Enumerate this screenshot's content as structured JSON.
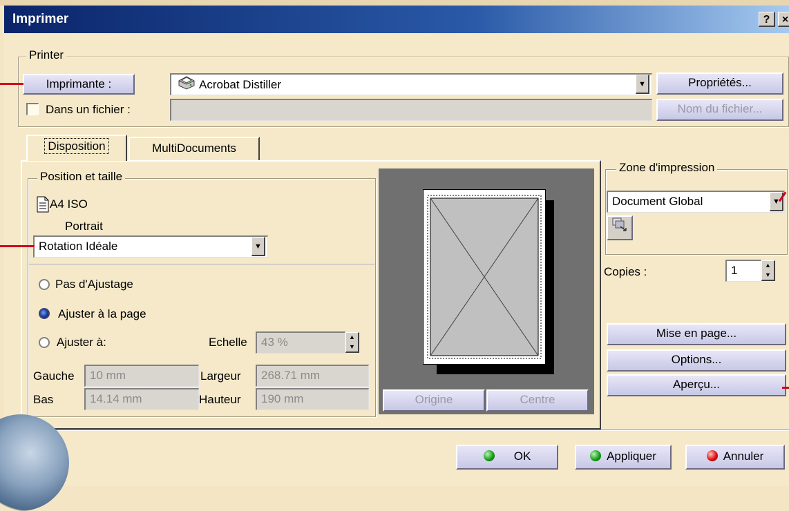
{
  "window": {
    "title": "Imprimer",
    "help_label": "?",
    "close_label": "×"
  },
  "printer_group": {
    "label": "Printer",
    "printer_button": "Imprimante :",
    "printer_name": "Acrobat Distiller",
    "properties_button": "Propriétés...",
    "to_file_label": "Dans un fichier :",
    "to_file_checked": false,
    "file_path": "",
    "file_name_button": "Nom du fichier..."
  },
  "tabs": [
    {
      "label": "Disposition",
      "active": true
    },
    {
      "label": "MultiDocuments",
      "active": false
    }
  ],
  "position_group": {
    "label": "Position et taille",
    "paper": "A4 ISO",
    "orientation": "Portrait",
    "rotation_selected": "Rotation Idéale",
    "radio_no_fit": "Pas d'Ajustage",
    "radio_fit_page": "Ajuster à la page",
    "radio_fit_to": "Ajuster à:",
    "selected_fit": "Ajuster à la page",
    "scale_label": "Echelle",
    "scale_value": "43 %",
    "left_label": "Gauche",
    "left_value": "10 mm",
    "bottom_label": "Bas",
    "bottom_value": "14.14 mm",
    "width_label": "Largeur",
    "width_value": "268.71 mm",
    "height_label": "Hauteur",
    "height_value": "190 mm"
  },
  "preview": {
    "origin_button": "Origine",
    "center_button": "Centre"
  },
  "print_zone": {
    "label": "Zone d'impression",
    "selected": "Document Global"
  },
  "copies": {
    "label": "Copies :",
    "value": "1"
  },
  "side_buttons": {
    "page_setup": "Mise en page...",
    "options": "Options...",
    "preview": "Aperçu..."
  },
  "footer": {
    "ok": "OK",
    "apply": "Appliquer",
    "cancel": "Annuler"
  },
  "colors": {
    "titlebar": "#0a246a",
    "dialog_bg": "#f5e9c9",
    "annotation": "#d2001e",
    "button_face": "#d7d6ef"
  }
}
